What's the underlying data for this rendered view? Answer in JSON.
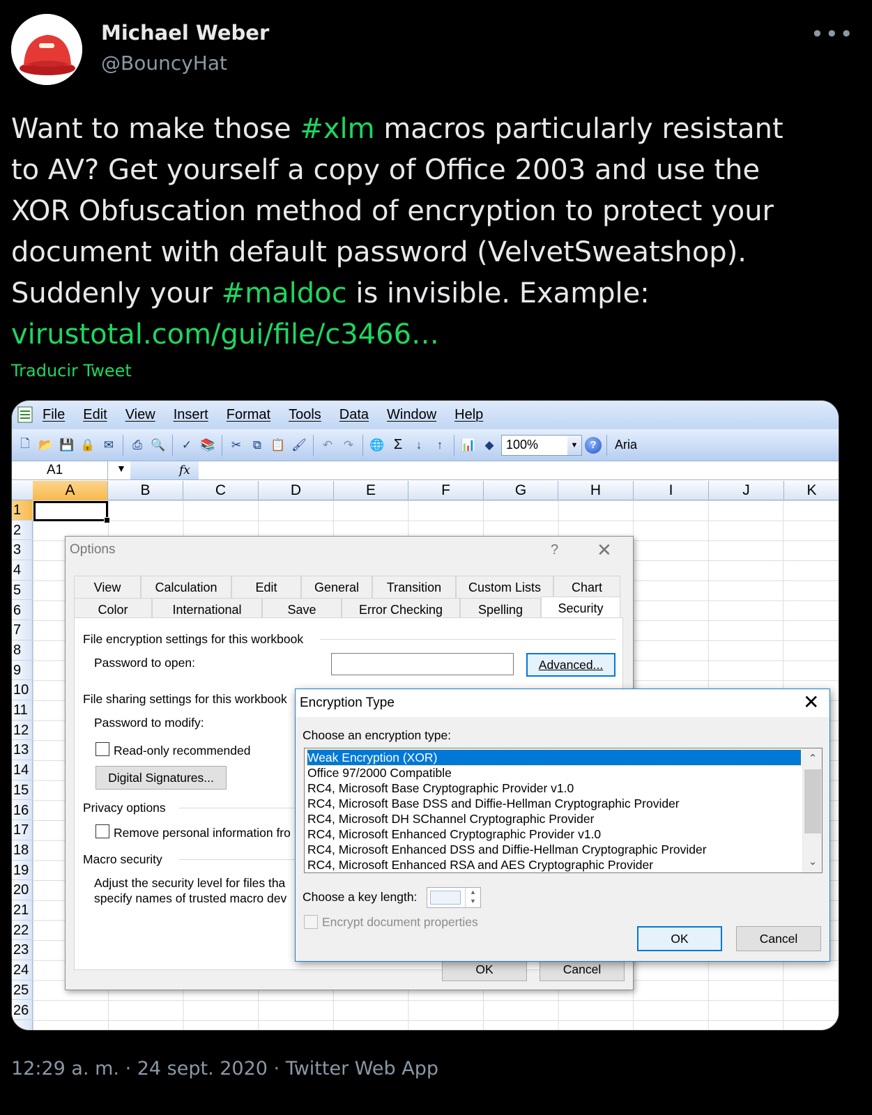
{
  "author": {
    "name": "Michael Weber",
    "handle": "@BouncyHat"
  },
  "tweet": {
    "line1_a": "Want to make those ",
    "hashtag1": "#xlm",
    "line1_b": " macros particularly resistant",
    "line2": "to AV? Get yourself a copy of Office 2003 and use the",
    "line3": "XOR Obfuscation method of encryption to protect your",
    "line4": "document with default password (VelvetSweatshop).",
    "line5_a": "Suddenly your ",
    "hashtag2": "#maldoc",
    "line5_b": " is invisible. Example:",
    "link": "virustotal.com/gui/file/c3466…",
    "translate_label": "Traducir Tweet",
    "footer": "12:29 a. m. · 24 sept. 2020 · Twitter Web App"
  },
  "excel": {
    "menu": [
      "File",
      "Edit",
      "View",
      "Insert",
      "Format",
      "Tools",
      "Data",
      "Window",
      "Help"
    ],
    "zoom": "100%",
    "font": "Aria",
    "namebox": "A1",
    "fx": "fx",
    "columns": [
      "A",
      "B",
      "C",
      "D",
      "E",
      "F",
      "G",
      "H",
      "I",
      "J",
      "K"
    ],
    "rows": [
      "1",
      "2",
      "3",
      "4",
      "5",
      "6",
      "7",
      "8",
      "9",
      "10",
      "11",
      "12",
      "13",
      "14",
      "15",
      "16",
      "17",
      "18",
      "19",
      "20",
      "21",
      "22",
      "23",
      "24",
      "25",
      "26"
    ]
  },
  "options_dialog": {
    "title": "Options",
    "help": "?",
    "tabs_row1": [
      "View",
      "Calculation",
      "Edit",
      "General",
      "Transition",
      "Custom Lists",
      "Chart"
    ],
    "tabs_row2": [
      "Color",
      "International",
      "Save",
      "Error Checking",
      "Spelling",
      "Security"
    ],
    "file_encryption_label": "File encryption settings for this workbook",
    "password_open_label": "Password to open:",
    "advanced_button": "Advanced...",
    "file_sharing_label": "File sharing settings for this workbook",
    "password_modify_label": "Password to modify:",
    "readonly_label": "Read-only recommended",
    "digital_signatures_button": "Digital Signatures...",
    "privacy_label": "Privacy options",
    "remove_personal_label": "Remove personal information fro",
    "macro_security_label": "Macro security",
    "macro_text_1": "Adjust the security level for files tha",
    "macro_text_2": "specify names of trusted macro dev",
    "ok_button": "OK",
    "cancel_button": "Cancel"
  },
  "encryption_dialog": {
    "title": "Encryption Type",
    "choose_label": "Choose an encryption type:",
    "options": [
      "Weak Encryption (XOR)",
      "Office 97/2000 Compatible",
      "RC4, Microsoft Base Cryptographic Provider v1.0",
      "RC4, Microsoft Base DSS and Diffie-Hellman Cryptographic Provider",
      "RC4, Microsoft DH SChannel Cryptographic Provider",
      "RC4, Microsoft Enhanced Cryptographic Provider v1.0",
      "RC4, Microsoft Enhanced DSS and Diffie-Hellman Cryptographic Provider",
      "RC4, Microsoft Enhanced RSA and AES Cryptographic Provider"
    ],
    "key_length_label": "Choose a key length:",
    "encrypt_props_label": "Encrypt document properties",
    "ok_button": "OK",
    "cancel_button": "Cancel"
  }
}
